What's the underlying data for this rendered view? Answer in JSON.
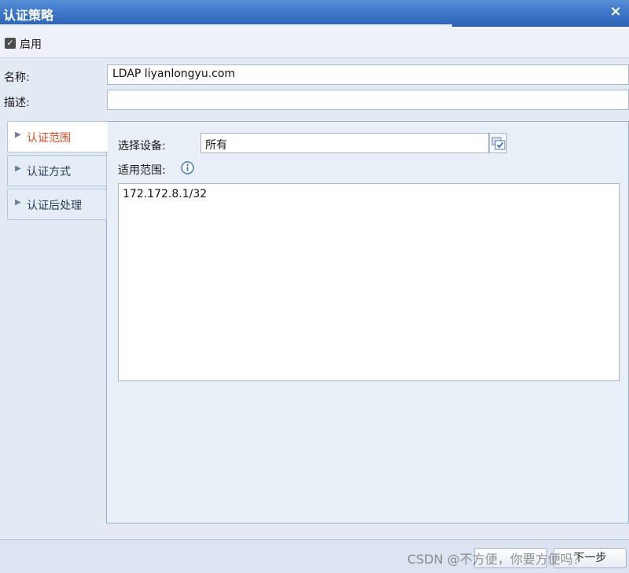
{
  "window": {
    "title": "认证策略",
    "close_glyph": "×"
  },
  "enable": {
    "checked": true,
    "label": "启用"
  },
  "form": {
    "name_label": "名称:",
    "name_value": "LDAP liyanlongyu.com",
    "desc_label": "描述:",
    "desc_value": ""
  },
  "tabs": [
    {
      "label": "认证范围",
      "active": true
    },
    {
      "label": "认证方式",
      "active": false
    },
    {
      "label": "认证后处理",
      "active": false
    }
  ],
  "scope": {
    "device_label": "选择设备:",
    "device_value": "所有",
    "range_label": "适用范围:",
    "range_value": "172.172.8.1/32"
  },
  "footer": {
    "prev_label": "",
    "next_label": "下一步"
  },
  "watermark": "CSDN @不方便，你要方便吗？",
  "colors": {
    "titlebar": "#3f78c8",
    "active_tab_text": "#e04a1f",
    "background": "#e4eaf3"
  },
  "icons": {
    "close": "close-icon",
    "checkbox": "checkbox-icon",
    "tab_arrow": "chevron-right-icon",
    "select_device": "select-device-icon",
    "info": "info-icon"
  }
}
